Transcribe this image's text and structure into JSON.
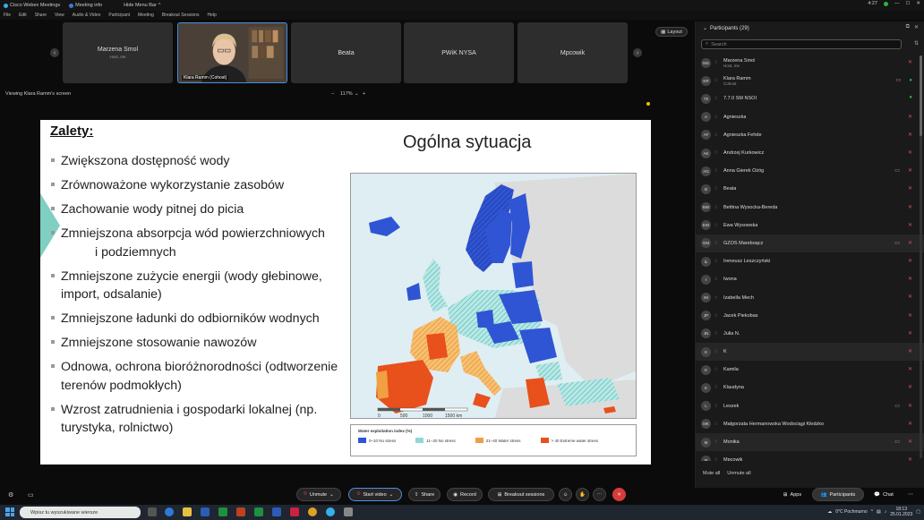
{
  "titlebar": {
    "app_name": "Cisco Webex Meetings",
    "meeting_info": "Meeting info",
    "hide_menu": "Hide Menu Bar",
    "time": "4:27"
  },
  "menubar": [
    "File",
    "Edit",
    "Share",
    "View",
    "Audio & Video",
    "Participant",
    "Meeting",
    "Breakout Sessions",
    "Help"
  ],
  "video_tiles": [
    {
      "name": "Marzena Smol",
      "sub": "Host, me"
    },
    {
      "name": "Klara Ramm (Cohost)",
      "sub": ""
    },
    {
      "name": "Beata",
      "sub": ""
    },
    {
      "name": "PWiK NYSA",
      "sub": ""
    },
    {
      "name": "Mpcowik",
      "sub": ""
    }
  ],
  "layout_label": "Layout",
  "viewing_label": "Viewing Klara Ramm's screen",
  "zoom_label": "117%",
  "slide": {
    "heading": "Zalety:",
    "title": "Ogólna sytuacja",
    "bullets": [
      "Zwiększona dostępność wody",
      "Zrównoważone wykorzystanie zasobów",
      "Zachowanie wody pitnej do picia",
      "Zmniejszona absorpcja wód powierzchniowych",
      "i podziemnych",
      "Zmniejszone zużycie energii (wody głebinowe, import, odsalanie)",
      "Zmniejszone ładunki do odbiorników wodnych",
      "Zmniejszone stosowanie nawozów",
      "Odnowa, ochrona bioróżnorodności (odtworzenie terenów podmokłych)",
      "Wzrost zatrudnienia i gospodarki lokalnej (np. turystyka, rolnictwo)"
    ],
    "legend_title": "Water exploitation index (%)",
    "legend_items": [
      {
        "label": "0–10 No stress",
        "color": "#2f55d4"
      },
      {
        "label": "11–20 No stress",
        "color": "#8fd8d8"
      },
      {
        "label": "21–40 Water stress",
        "color": "#f0a040"
      },
      {
        "label": "> 40 Extreme water stress",
        "color": "#e8501c"
      }
    ],
    "scale_labels": [
      "0",
      "500",
      "1000",
      "1500 km"
    ]
  },
  "participants": {
    "header": "Participants (29)",
    "search_placeholder": "Search",
    "list": [
      {
        "initials": "MS",
        "name": "Marzena Smol",
        "sub": "Host, me",
        "muted": true,
        "sharing": false
      },
      {
        "initials": "KR",
        "name": "Klara Ramm",
        "sub": "Cohost",
        "muted": false,
        "sharing": true
      },
      {
        "initials": "7Z",
        "name": "7.7.0 SM NSOI",
        "sub": "",
        "muted": false,
        "sharing": false
      },
      {
        "initials": "A",
        "name": "Agnieszka",
        "sub": "",
        "muted": true,
        "sharing": false
      },
      {
        "initials": "AF",
        "name": "Agnieszka Fehde",
        "sub": "",
        "muted": true,
        "sharing": false
      },
      {
        "initials": "AK",
        "name": "Andrzej Kurkowicz",
        "sub": "",
        "muted": true,
        "sharing": false
      },
      {
        "initials": "AG",
        "name": "Anna Gierek Ożóg",
        "sub": "",
        "muted": true,
        "sharing": true
      },
      {
        "initials": "B",
        "name": "Beata",
        "sub": "",
        "muted": true,
        "sharing": false
      },
      {
        "initials": "BW",
        "name": "Bettina Wysocka-Bereda",
        "sub": "",
        "muted": true,
        "sharing": false
      },
      {
        "initials": "EW",
        "name": "Ewa Wysowska",
        "sub": "",
        "muted": true,
        "sharing": false
      },
      {
        "initials": "GM",
        "name": "GZOŚ Mareboącz",
        "sub": "",
        "muted": true,
        "sharing": true
      },
      {
        "initials": "IL",
        "name": "Ireneusz Leszczyński",
        "sub": "",
        "muted": true,
        "sharing": false
      },
      {
        "initials": "I",
        "name": "Iwona",
        "sub": "",
        "muted": true,
        "sharing": false
      },
      {
        "initials": "IM",
        "name": "Izabella Mech",
        "sub": "",
        "muted": true,
        "sharing": false
      },
      {
        "initials": "JP",
        "name": "Jacek Piekobas",
        "sub": "",
        "muted": true,
        "sharing": false
      },
      {
        "initials": "JN",
        "name": "Julia N.",
        "sub": "",
        "muted": true,
        "sharing": false
      },
      {
        "initials": "K",
        "name": "K",
        "sub": "",
        "muted": true,
        "sharing": false
      },
      {
        "initials": "K",
        "name": "Kamila",
        "sub": "",
        "muted": true,
        "sharing": false
      },
      {
        "initials": "K",
        "name": "Klaudyna",
        "sub": "",
        "muted": true,
        "sharing": false
      },
      {
        "initials": "L",
        "name": "Leszek",
        "sub": "",
        "muted": true,
        "sharing": true
      },
      {
        "initials": "MK",
        "name": "Małgorzata Hermanowska Wodociągi Kłodzko",
        "sub": "",
        "muted": true,
        "sharing": false
      },
      {
        "initials": "M",
        "name": "Monika",
        "sub": "",
        "muted": true,
        "sharing": true
      },
      {
        "initials": "M",
        "name": "Mpcowik",
        "sub": "",
        "muted": true,
        "sharing": false
      }
    ],
    "footer_mute_all": "Mute all",
    "footer_unmute_all": "Unmute all"
  },
  "controls": {
    "unmute": "Unmute",
    "start_video": "Start video",
    "share": "Share",
    "record": "Record",
    "breakout": "Breakout sessions",
    "apps": "Apps",
    "participants": "Participants",
    "chat": "Chat"
  },
  "taskbar": {
    "search_placeholder": "Wpisz tu wyszukiwane wiersze",
    "weather": "0°C Pochmurno",
    "clock_time": "18:13",
    "clock_date": "25.01.2023"
  }
}
